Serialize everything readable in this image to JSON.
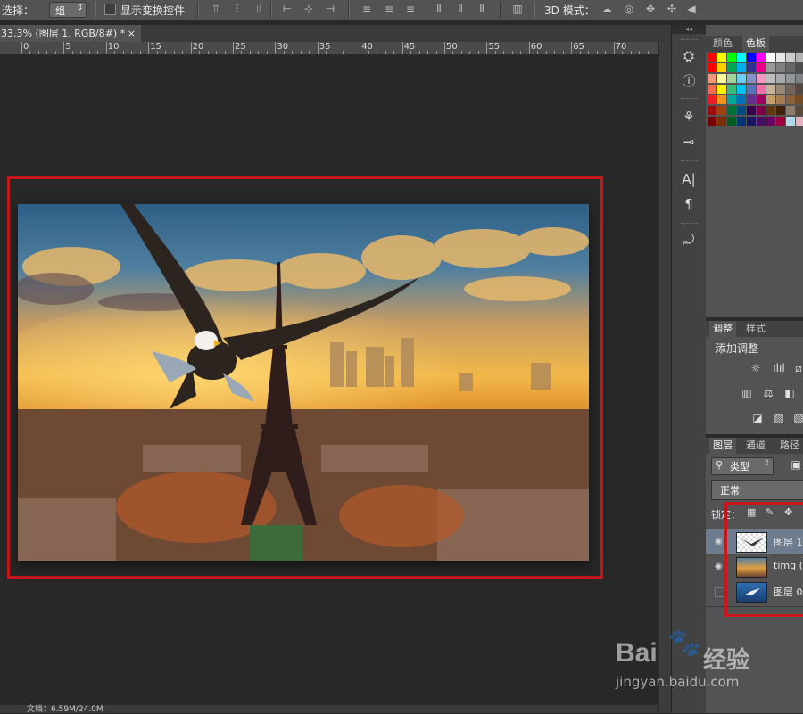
{
  "options_bar": {
    "select_label": "选择：",
    "select_value": "组",
    "show_transform_label": "显示变换控件",
    "mode_3d_label": "3D 模式："
  },
  "document_tab": {
    "title": "33.3% (图层 1, RGB/8#) *",
    "close_glyph": "×"
  },
  "ruler": {
    "labels": [
      "0",
      "5",
      "10",
      "15",
      "20",
      "25",
      "30",
      "35",
      "40",
      "45",
      "50",
      "55",
      "60",
      "65",
      "70"
    ]
  },
  "color_panel": {
    "tabs": [
      "颜色",
      "色板"
    ],
    "active_tab": "色板",
    "swatches": [
      [
        "#ff0000",
        "#ffff00",
        "#00ff00",
        "#00ffff",
        "#0000ff",
        "#ff00ff",
        "#ffffff",
        "#e6e6e6",
        "#cccccc",
        "#b3b3b3"
      ],
      [
        "#ff0000",
        "#ffd200",
        "#00a651",
        "#00aeef",
        "#2e3192",
        "#ec008c",
        "#999999",
        "#808080",
        "#666666",
        "#4d4d4d"
      ],
      [
        "#f7977a",
        "#fff799",
        "#a3d39c",
        "#6dcff6",
        "#8393ca",
        "#f49ac2",
        "#bcbec0",
        "#a7a9ac",
        "#939598",
        "#808285"
      ],
      [
        "#f26c4f",
        "#fff200",
        "#3cb878",
        "#00bff3",
        "#5674b9",
        "#f06eaa",
        "#c7b299",
        "#998675",
        "#736357",
        "#534741"
      ],
      [
        "#ed1c24",
        "#f7941d",
        "#00a99d",
        "#0072bc",
        "#662d91",
        "#9e005d",
        "#c69c6d",
        "#a67c52",
        "#8c6239",
        "#754c24"
      ],
      [
        "#9e0b0f",
        "#a0410d",
        "#007236",
        "#004a80",
        "#32004b",
        "#7b0046",
        "#603913",
        "#42210b",
        "#8b7d6b",
        "#5a4a3a"
      ],
      [
        "#790000",
        "#7b2e00",
        "#005e20",
        "#003471",
        "#1b1464",
        "#440e62",
        "#630460",
        "#9e0039",
        "#b3d9e6",
        "#e6b3c2"
      ]
    ]
  },
  "adjust_panel": {
    "tabs": [
      "调整",
      "样式"
    ],
    "active_tab": "调整",
    "heading": "添加调整"
  },
  "layers_panel": {
    "tabs": [
      "图层",
      "通道",
      "路径"
    ],
    "active_tab": "图层",
    "filter_label": "类型",
    "blend_mode": "正常",
    "lock_label": "锁定：",
    "layers": [
      {
        "name": "图层 1",
        "visible": true,
        "selected": true
      },
      {
        "name": "timg (",
        "visible": true,
        "selected": false
      },
      {
        "name": "图层 0",
        "visible": false,
        "selected": false
      }
    ]
  },
  "status": {
    "text": "文档：6.59M/24.0M"
  },
  "watermark": {
    "brand": "Bai",
    "brand2": "经验",
    "url": "jingyan.baidu.com"
  },
  "colors": {
    "highlight_red": "#c8161a",
    "panel_bg": "#535353",
    "canvas_bg": "#282828"
  }
}
